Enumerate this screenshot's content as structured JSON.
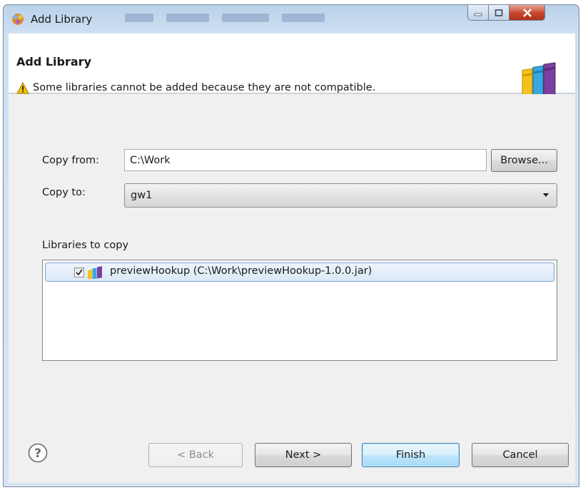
{
  "window": {
    "title": "Add Library",
    "icons": {
      "app": "library-app-icon",
      "minimize": "minimize-icon",
      "maximize": "maximize-icon",
      "close": "close-icon"
    }
  },
  "header": {
    "title": "Add Library",
    "message": "Some libraries cannot be added because they are not compatible.",
    "warning_icon": "warning-icon",
    "banner_icon": "books-icon"
  },
  "form": {
    "copy_from_label": "Copy from:",
    "copy_from_value": "C:\\Work",
    "browse_label": "Browse...",
    "copy_to_label": "Copy to:",
    "copy_to_value": "gw1",
    "libraries_label": "Libraries to copy",
    "libraries": [
      {
        "checked": true,
        "label": "previewHookup (C:\\Work\\previewHookup-1.0.0.jar)",
        "icon": "library-icon"
      }
    ]
  },
  "footer": {
    "help_icon": "help-icon",
    "back_label": "< Back",
    "next_label": "Next >",
    "finish_label": "Finish",
    "cancel_label": "Cancel"
  },
  "colors": {
    "close_button": "#c7462c",
    "default_button": "#3c7fb1",
    "title_bar": "#b9d1ea",
    "warning": "#f2c200"
  }
}
